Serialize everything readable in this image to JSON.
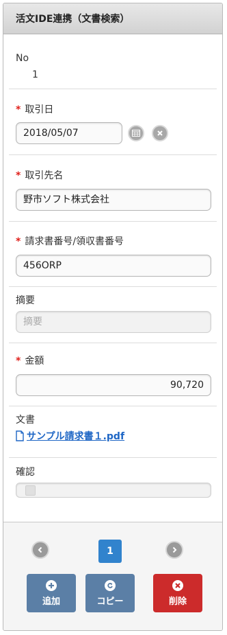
{
  "header": {
    "title": "活文IDE連携（文書検索）"
  },
  "form": {
    "no": {
      "label": "No",
      "value": "1"
    },
    "date": {
      "label": "取引日",
      "value": "2018/05/07"
    },
    "partner": {
      "label": "取引先名",
      "value": "野市ソフト株式会社"
    },
    "invoice": {
      "label": "請求書番号/領収書番号",
      "value": "456ORP"
    },
    "summary": {
      "label": "摘要",
      "placeholder": "摘要"
    },
    "amount": {
      "label": "金額",
      "value": "90,720"
    },
    "document": {
      "label": "文書",
      "link": "サンプル請求書１.pdf"
    },
    "confirm": {
      "label": "確認"
    }
  },
  "pager": {
    "current": "1"
  },
  "actions": {
    "add": "追加",
    "copy": "コピー",
    "delete": "削除"
  },
  "colors": {
    "required": "#e0201b",
    "link": "#1e66c5",
    "page_active": "#3183cd",
    "button_blue": "#5b7fa6",
    "button_red": "#cc2b2b"
  }
}
